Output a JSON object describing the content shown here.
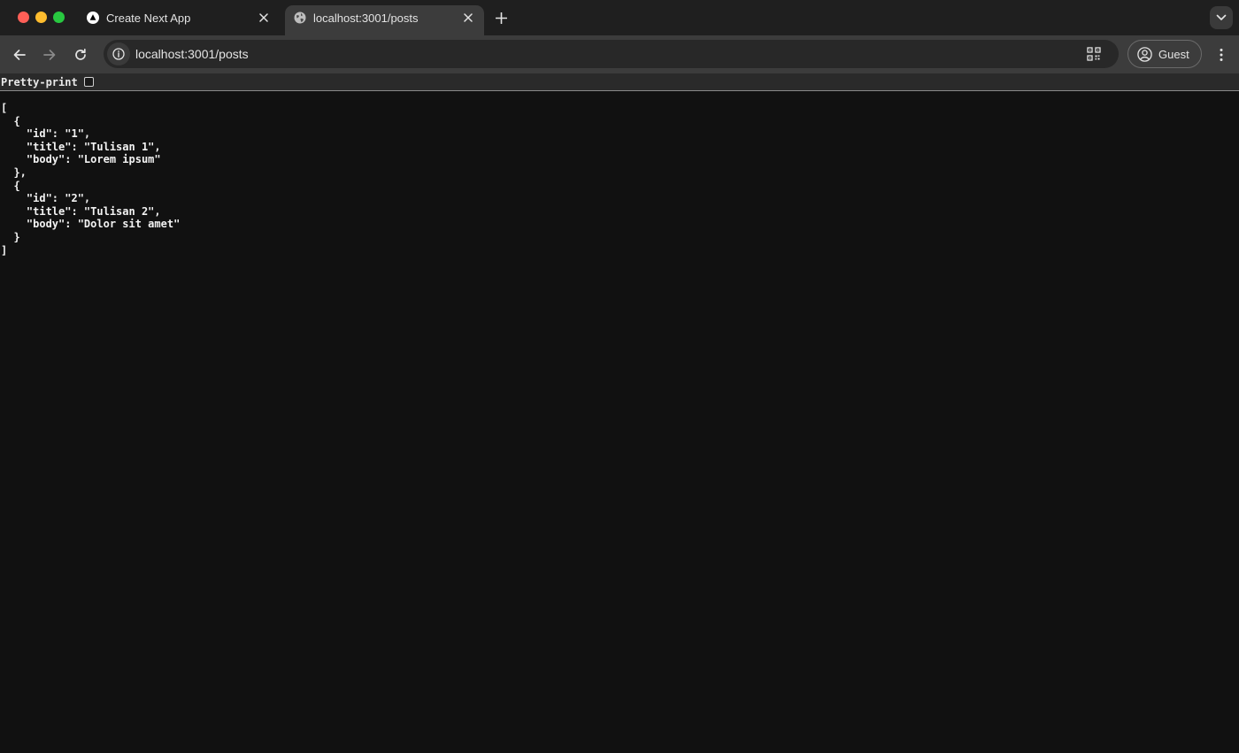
{
  "tabs": [
    {
      "title": "Create Next App",
      "icon": "nextjs-triangle-icon",
      "active": false
    },
    {
      "title": "localhost:3001/posts",
      "icon": "globe-icon",
      "active": true
    }
  ],
  "toolbar": {
    "url": "localhost:3001/posts",
    "profile_label": "Guest"
  },
  "viewer": {
    "pretty_print_label": "Pretty-print",
    "pretty_print_checked": false
  },
  "json_lines": [
    "[",
    "  {",
    "    \"id\": \"1\",",
    "    \"title\": \"Tulisan 1\",",
    "    \"body\": \"Lorem ipsum\"",
    "  },",
    "  {",
    "    \"id\": \"2\",",
    "    \"title\": \"Tulisan 2\",",
    "    \"body\": \"Dolor sit amet\"",
    "  }",
    "]"
  ],
  "colors": {
    "tabstrip_bg": "#1f1f1f",
    "toolbar_bg": "#3c3c3c",
    "page_bg": "#111111",
    "traffic_close": "#fe5f57",
    "traffic_minimize": "#febc2e",
    "traffic_maximize": "#28c840"
  }
}
